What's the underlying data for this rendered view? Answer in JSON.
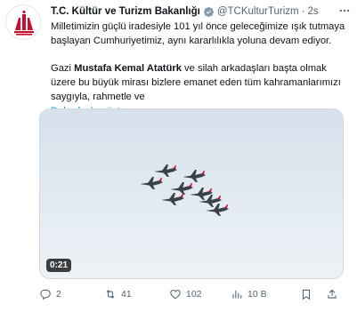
{
  "tweet": {
    "author_name": "T.C. Kültür ve Turizm Bakanlığı",
    "handle": "@TCKulturTurizm",
    "separator": "·",
    "time": "2s",
    "more_icon": "more-icon",
    "paragraph1": "Milletimizin güçlü iradesiyle 101 yıl önce geleceğimize ışık tutmaya başlayan Cumhuriyetimiz, aynı kararlılıkla yoluna devam ediyor.",
    "paragraph2_prefix": "Gazi ",
    "paragraph2_bold": "Mustafa Kemal Atatürk",
    "paragraph2_suffix": " ve silah arkadaşları başta olmak üzere bu büyük mirası bizlere emanet eden tüm kahramanlarımızı saygıyla, rahmetle ve",
    "show_more": "Daha fazla göster",
    "video_duration": "0:21"
  },
  "actions": {
    "replies": "2",
    "retweets": "41",
    "likes": "102",
    "views": "10 B"
  },
  "colors": {
    "link": "#1d9bf0",
    "muted": "#536471",
    "verified_badge": "#829aab",
    "logo_red": "#c8102e",
    "sky_top": "#d9e4ee",
    "sky_bottom": "#eef2f6"
  }
}
